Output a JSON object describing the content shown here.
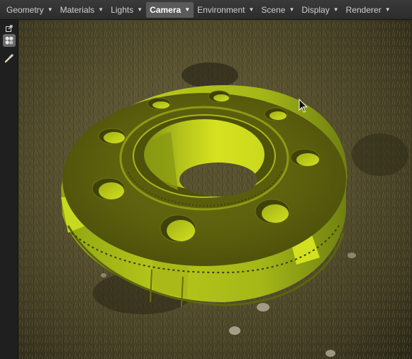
{
  "menubar": {
    "items": [
      {
        "label": "Geometry"
      },
      {
        "label": "Materials"
      },
      {
        "label": "Lights"
      },
      {
        "label": "Camera",
        "active": true
      },
      {
        "label": "Environment"
      },
      {
        "label": "Scene"
      },
      {
        "label": "Display"
      },
      {
        "label": "Renderer"
      }
    ],
    "caret_glyph": "▼"
  },
  "toolstrip": {
    "tools": [
      {
        "icon": "pop-out-icon"
      },
      {
        "icon": "material-palette-icon",
        "selected": true
      },
      {
        "icon": "eyedropper-icon"
      }
    ]
  },
  "viewport": {
    "model_color": "#a6b41e",
    "environment": "grass-ground-hdri",
    "model": "flange-with-bolt-holes"
  }
}
